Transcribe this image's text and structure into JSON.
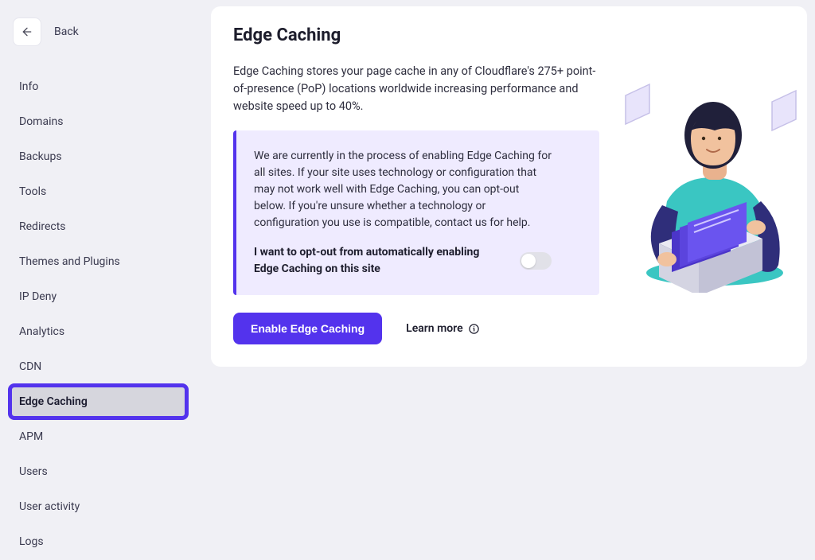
{
  "back_label": "Back",
  "sidebar": {
    "items": [
      {
        "label": "Info"
      },
      {
        "label": "Domains"
      },
      {
        "label": "Backups"
      },
      {
        "label": "Tools"
      },
      {
        "label": "Redirects"
      },
      {
        "label": "Themes and Plugins"
      },
      {
        "label": "IP Deny"
      },
      {
        "label": "Analytics"
      },
      {
        "label": "CDN"
      },
      {
        "label": "Edge Caching"
      },
      {
        "label": "APM"
      },
      {
        "label": "Users"
      },
      {
        "label": "User activity"
      },
      {
        "label": "Logs"
      }
    ],
    "active_index": 9
  },
  "page": {
    "title": "Edge Caching",
    "description": "Edge Caching stores your page cache in any of Cloudflare's 275+ point-of-presence (PoP) locations worldwide increasing performance and website speed up to 40%.",
    "notice_text": "We are currently in the process of enabling Edge Caching for all sites. If your site uses technology or configuration that may not work well with Edge Caching, you can opt-out below. If you're unsure whether a technology or configuration you use is compatible, contact us for help.",
    "optout_label": "I want to opt-out from automatically enabling Edge Caching on this site",
    "optout_checked": false,
    "enable_button": "Enable Edge Caching",
    "learn_more": "Learn more"
  },
  "colors": {
    "accent": "#5333ed",
    "notice_bg": "#efebff"
  }
}
